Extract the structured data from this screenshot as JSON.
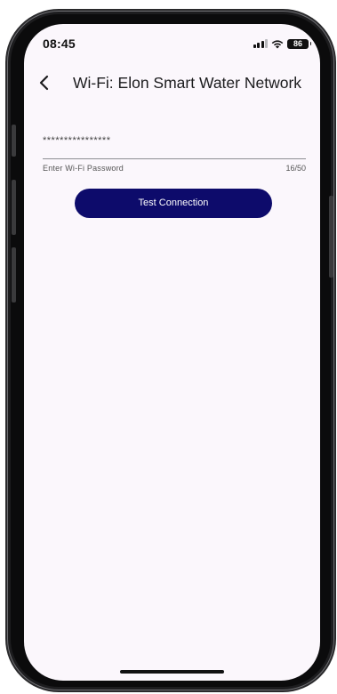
{
  "status_bar": {
    "time": "08:45",
    "battery": "86"
  },
  "header": {
    "title": "Wi-Fi: Elon Smart Water Network"
  },
  "password_field": {
    "value": "****************",
    "helper": "Enter Wi-Fi Password",
    "counter": "16/50"
  },
  "actions": {
    "test_connection_label": "Test Connection"
  },
  "colors": {
    "screen_background": "#fbf7fc",
    "primary_button": "#0d0b6b",
    "text_primary": "#1c1c1e",
    "text_secondary": "#555555"
  },
  "icons": {
    "back": "chevron-left-icon",
    "signal": "cellular-signal-icon",
    "wifi": "wifi-icon",
    "battery": "battery-icon"
  }
}
